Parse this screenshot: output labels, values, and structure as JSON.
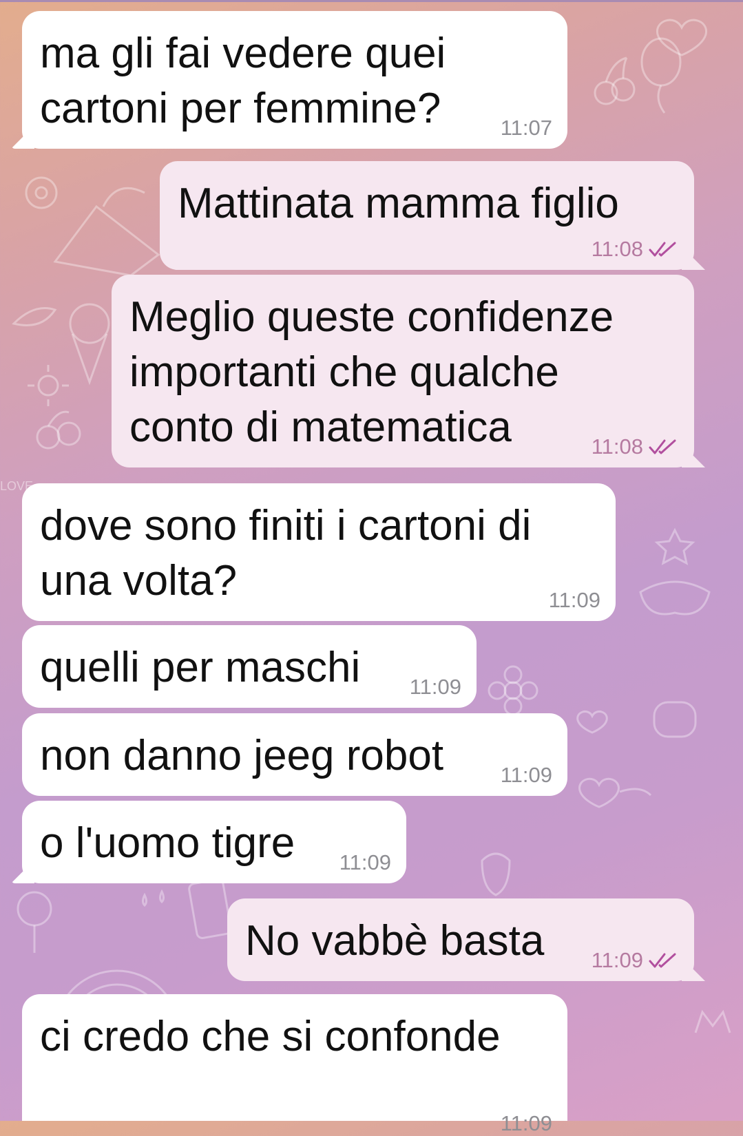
{
  "chat": {
    "messages": [
      {
        "direction": "incoming",
        "text": "ma gli fai vedere quei\ncartoni per femmine?",
        "time": "11:07"
      },
      {
        "direction": "outgoing",
        "text": "Mattinata mamma figlio",
        "time": "11:08",
        "status": "read"
      },
      {
        "direction": "outgoing",
        "text": "Meglio queste confidenze\nimportanti che qualche\nconto di matematica",
        "time": "11:08",
        "status": "read"
      },
      {
        "direction": "incoming",
        "text": "dove sono finiti i cartoni di\nuna volta?",
        "time": "11:09"
      },
      {
        "direction": "incoming",
        "text": "quelli per maschi",
        "time": "11:09"
      },
      {
        "direction": "incoming",
        "text": "non danno jeeg robot",
        "time": "11:09"
      },
      {
        "direction": "incoming",
        "text": "o l'uomo tigre",
        "time": "11:09"
      },
      {
        "direction": "outgoing",
        "text": "No vabbè basta",
        "time": "11:09",
        "status": "read"
      },
      {
        "direction": "incoming",
        "text": "ci credo che si confonde",
        "time": "11:09"
      }
    ]
  },
  "background": {
    "doodle_text": "LOVE",
    "colors": {
      "top": "#e3ad8d",
      "middle": "#c49ccd",
      "bottom": "#d9a0c6"
    }
  },
  "icons": {
    "read_status": "double-check-icon"
  },
  "colors": {
    "incoming_bubble": "#ffffff",
    "outgoing_bubble": "#f6e7f0",
    "time_outgoing": "#b57aa0",
    "time_incoming": "#8e8e93"
  }
}
